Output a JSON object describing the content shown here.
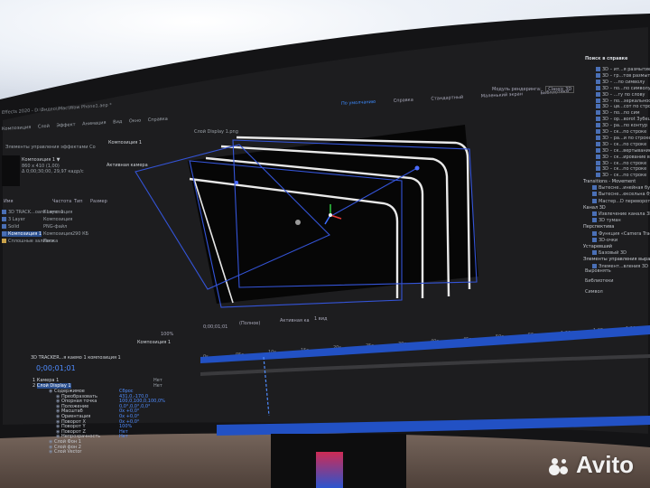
{
  "menu": {
    "items": [
      "Композиция",
      "Слой",
      "Эффект",
      "Анимация",
      "Вид",
      "Окно",
      "Справка"
    ]
  },
  "title_bar": {
    "text": "Effects 2020 - D:\\Видео\\iMac\\Wow Phone1.aep *"
  },
  "toolbar": {
    "tabs": [
      "По умолчанию",
      "Справка",
      "Стандартный",
      "Маленький экран",
      "Библиотеки"
    ],
    "active_tab": "По умолчанию",
    "renderer_label": "Модуль рендеринга:",
    "renderer_value": "Classic 3D"
  },
  "project_panel": {
    "effects_tab": "Элементы управления эффектами Co",
    "comp_name": "Композиция 1 ▼",
    "comp_info": [
      "860 x 410 (1,00)",
      "Δ 0;00;30;00, 29,97 кадр/с"
    ],
    "columns": [
      "Имя",
      "Частота",
      "Тип",
      "Размер"
    ],
    "items": [
      {
        "name": "3D TRACK...oard Layer 1",
        "type": "Композиция"
      },
      {
        "name": "3 Layer",
        "type": "Композиция"
      },
      {
        "name": "Solid",
        "type": "PNG-файл"
      },
      {
        "name": "Композиция 1",
        "type": "Композиция",
        "size": "290 КБ"
      },
      {
        "name": "Сплошные заливки",
        "type": "Папка"
      }
    ]
  },
  "comp_panel": {
    "tab": "Композиция 1",
    "layer_tab": "Слой Display 1.png",
    "view_label": "Активная камера",
    "zoom": "100%",
    "time": "0;00;01;01",
    "quality": "(Полное)",
    "camera": "Активная ка",
    "views": "1 вид"
  },
  "right_panel": {
    "search_title": "Поиск в справке",
    "effects": [
      "3D – ит...я размытие",
      "3D – гр...тов размытие",
      "3D – ...по символу",
      "3D – по...по символу",
      "3D – ...гу по слову",
      "3D – по...зеркальность",
      "3D – цв...сот по строке",
      "3D – по...по сим",
      "3D – ор...воrot Зубец",
      "3D – ра...по контур",
      "3D – ск...по строке",
      "3D – ра...и по строке",
      "3D – ск...по строке",
      "3D – ск...вертывание",
      "3D – ск...ирование вверх",
      "3D – ск...по строке",
      "3D – ск...по строке",
      "3D – ск...по строке"
    ],
    "groups": [
      {
        "label": "Transitions - Movement",
        "items": [
          "Вытесне...инейная бу",
          "Вытесне...ексельна бу",
          "Мастер...D переворот"
        ]
      },
      {
        "label": "Канал 3D",
        "items": [
          "Извлечение канала 3D",
          "3D туман"
        ]
      },
      {
        "label": "Перспектива",
        "items": [
          "Функция «Camera Tracker»",
          "3D-очки"
        ]
      },
      {
        "label": "Устаревший",
        "items": [
          "Базовый 3D"
        ]
      },
      {
        "label": "Элементы управления выражениями",
        "items": [
          "Элемент...вления 3D"
        ]
      }
    ],
    "bottom": [
      "Выровнять",
      "Библиотеки",
      "Символ"
    ]
  },
  "timeline": {
    "tab": "Композиция 1",
    "current_time": "0;00;01;01",
    "layer_tab": "3D TRACKER...я каемо 1 композиция 1",
    "ruler": [
      "0s",
      "05s",
      "10s",
      "15s",
      "20s",
      "25s",
      "30s",
      "40s",
      "45s",
      "50s",
      "55s",
      "1:00s",
      "1:05s",
      "1:10s"
    ],
    "layers": [
      {
        "num": "1",
        "name": "Камера 1",
        "mode": "Нет"
      },
      {
        "num": "2",
        "name": "Слой Display 1",
        "mode": "Нет"
      }
    ],
    "properties": [
      "Содержимое",
      "Преобразовать",
      "Опорная точка",
      "Положение",
      "Масштаб",
      "Ориентация",
      "Поворот X",
      "Поворот Y",
      "Поворот Z",
      "Непрозрачность",
      "Слой Фон 1",
      "Слой фон 2",
      "Слой Vector"
    ],
    "values": [
      "Сброс",
      "431,0,-170,0",
      "100,0,100,0,100,0%",
      "0,0°,0,0°,0,0°",
      "0x +0,0°",
      "0x +0,0°",
      "0x +0,0°",
      "100%",
      "Нет",
      "Нет"
    ]
  },
  "watermark": {
    "text": "Avito"
  }
}
